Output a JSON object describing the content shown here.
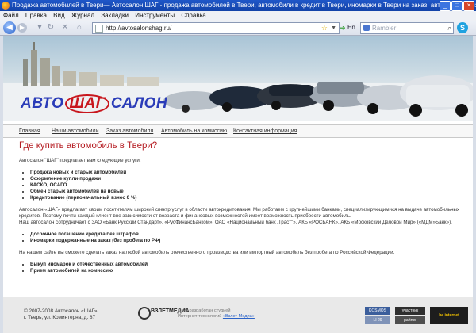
{
  "window": {
    "title": "Продажа автомобилей в Твери— Автосалон ШАГ - продажа автомобилей в Твери, автомобили в кредит в Твери, иномарки в Твери на заказ, автомобили бизн..."
  },
  "menu": [
    "Файл",
    "Правка",
    "Вид",
    "Журнал",
    "Закладки",
    "Инструменты",
    "Справка"
  ],
  "toolbar": {
    "url": "http://avtosalonshag.ru/",
    "language": "En",
    "search_placeholder": "Rambler"
  },
  "site": {
    "logo": {
      "left": "АВТО",
      "middle": "ШАГ",
      "right": "САЛОН"
    },
    "nav": [
      "Главная",
      "Наши автомобили",
      "Заказ автомобиля",
      "Автомобиль на комиссию",
      "Контактная информация"
    ],
    "heading": "Где купить автомобиль в Твери?",
    "intro": "Автосалон \"ШАГ\" предлагает вам следующие услуги:",
    "services": [
      "Продажа новых и старых автомобилей",
      "Оформление купли-продажи",
      "КАСКО, ОСАГО",
      "Обмен старых автомобилей на новые",
      "Кредитование (первоначальный взнос 0 %)"
    ],
    "credit_paragraph": "Автосалон «ШАГ» предлагает своим посетителям широкий спектр услуг в области автокредитования. Мы работаем с крупнейшими банками, специализирующимися на выдаче автомобильных кредитов. Поэтому почти каждый клиент вне зависимости от возраста и финансовых возможностей имеет возможность приобрести автомобиль.",
    "banks_paragraph": "Наш автосалон сотрудничает с ЗАО «Банк Русский Стандарт», «РусФинансБанком», ОАО «Национальный банк „Траст\"», АКБ «РОСБАНК», АКБ «Московский Деловой Мир» («МДМ»Банк»).",
    "credit_options": [
      "Досрочное погашение кредита без штрафов",
      "Иномарки подержанные на заказ (без пробега по РФ)"
    ],
    "order_paragraph": "На нашем сайте вы сможете сделать заказ на любой автомобиль отечественного производства или импортный автомобиль без пробега по Российской Федерации.",
    "extra_services": [
      "Выкуп иномарок и отечественных автомобилей",
      "Прием автомобилей на комиссию"
    ],
    "footer": {
      "copyright": "© 2007-2008 Автосалон «ШАГ»",
      "address": "г. Тверь, ул. Коминтерна, д. 87",
      "developer_name": "ВЗЛЕТМЕДИА",
      "developer_line1": "Сайт разработан студией",
      "developer_line2_prefix": "Интернет-технологий",
      "developer_link": "«Взлет Медиа»",
      "counters": [
        "KOSMOS",
        "LI 29",
        "участник",
        "partner",
        "be internet"
      ]
    }
  }
}
